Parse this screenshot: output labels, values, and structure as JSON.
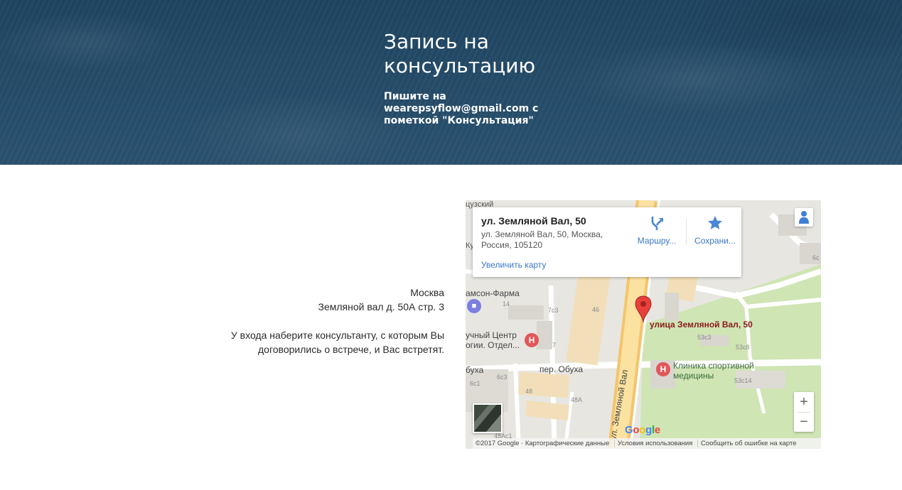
{
  "hero": {
    "title": "Запись на консультацию",
    "subtitle": "Пишите на wearepsyflow@gmail.com с пометкой \"Консультация\""
  },
  "address": {
    "city": "Москва",
    "street": "Земляной вал д. 50А стр. 3",
    "note_line1": "У входа наберите консультанту, с которым Вы",
    "note_line2": "договорились о встрече, и Вас встретят."
  },
  "map": {
    "card": {
      "title": "ул. Земляной Вал, 50",
      "address": "ул. Земляной Вал, 50, Москва, Россия, 105120",
      "zoom_link": "Увеличить карту",
      "route_label": "Маршру...",
      "save_label": "Сохрани..."
    },
    "pin_label": "улица Земляной Вал, 50",
    "poi": {
      "pharmacy": "амсон-Фарма",
      "science_center_1": "учный Центр",
      "science_center_2": "огии. Отдел...",
      "clinic_1": "Клиника спортивной",
      "clinic_2": "медицины",
      "top_left_1": "цузский",
      "top_left_2": "Ку"
    },
    "streets": {
      "obukha": "пер. Обуха",
      "obukha_left": "бухa",
      "zemlyanoy": "ул. Земляной Вал"
    },
    "building_numbers": [
      "14",
      "7с3",
      "46",
      "7",
      "6с3",
      "6с1",
      "48",
      "48А",
      "48Ас1",
      "53с3",
      "53с8",
      "53с14",
      "6с"
    ],
    "zoom_in": "+",
    "zoom_out": "−",
    "google": [
      "G",
      "o",
      "o",
      "g",
      "l",
      "e"
    ],
    "attribution": {
      "copyright": "©2017 Google · Картографические данные",
      "terms": "Условия использования",
      "report": "Сообщить об ошибке на карте"
    }
  }
}
